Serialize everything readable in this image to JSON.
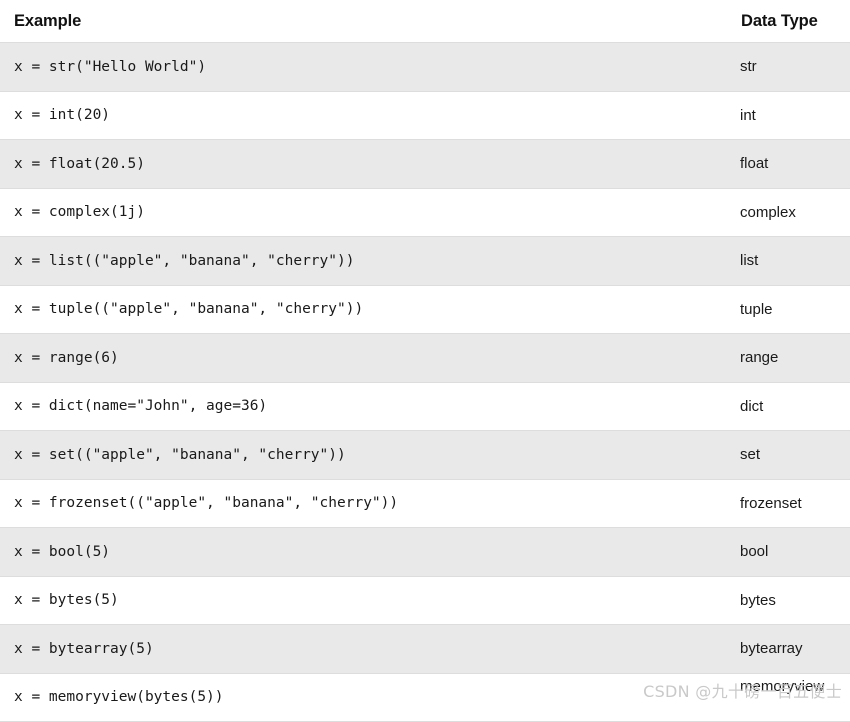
{
  "table": {
    "columns": [
      {
        "key": "example",
        "label": "Example"
      },
      {
        "key": "data_type",
        "label": "Data Type"
      }
    ],
    "rows": [
      {
        "example": "x = str(\"Hello World\")",
        "data_type": "str"
      },
      {
        "example": "x = int(20)",
        "data_type": "int"
      },
      {
        "example": "x = float(20.5)",
        "data_type": "float"
      },
      {
        "example": "x = complex(1j)",
        "data_type": "complex"
      },
      {
        "example": "x = list((\"apple\", \"banana\", \"cherry\"))",
        "data_type": "list"
      },
      {
        "example": "x = tuple((\"apple\", \"banana\", \"cherry\"))",
        "data_type": "tuple"
      },
      {
        "example": "x = range(6)",
        "data_type": "range"
      },
      {
        "example": "x = dict(name=\"John\", age=36)",
        "data_type": "dict"
      },
      {
        "example": "x = set((\"apple\", \"banana\", \"cherry\"))",
        "data_type": "set"
      },
      {
        "example": "x = frozenset((\"apple\", \"banana\", \"cherry\"))",
        "data_type": "frozenset"
      },
      {
        "example": "x = bool(5)",
        "data_type": "bool"
      },
      {
        "example": "x = bytes(5)",
        "data_type": "bytes"
      },
      {
        "example": "x = bytearray(5)",
        "data_type": "bytearray"
      },
      {
        "example": "x = memoryview(bytes(5))",
        "data_type": "memoryview"
      }
    ]
  },
  "watermark": {
    "text": "CSDN @九十磅一百五便士"
  },
  "colors": {
    "row_shaded": "#e9e9e9",
    "row_plain": "#ffffff",
    "row_border": "#dddddd",
    "text": "#1a1a1a",
    "header_text": "#111111",
    "watermark_text": "#c9c9c9"
  }
}
